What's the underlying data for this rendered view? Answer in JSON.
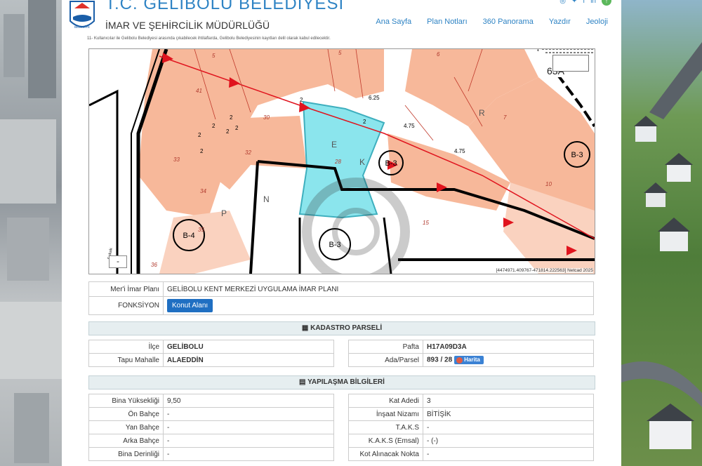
{
  "header": {
    "title": "T.C. GELİBOLU BELEDİYESİ",
    "subtitle": "İMAR VE ŞEHİRCİLİK MÜDÜRLÜĞÜ",
    "logo_text": "BELEDİYE",
    "nav": [
      "Ana Sayfa",
      "Plan Notları",
      "360 Panorama",
      "Yazdır",
      "Jeoloji"
    ],
    "social_icons": [
      "globe-icon",
      "twitter-icon",
      "facebook-icon",
      "linkedin-icon"
    ]
  },
  "notice": "11- Kullanıcılar ile Gelibolu Belediyesi arasında çıkabilecek ihtilaflarda, Gelibolu Belediyesinin kayıtları delil olarak kabul edilecektir.",
  "map": {
    "coordinates": "[4474971.409767-471814.222563] Netcad 2025",
    "zoom_out": "-",
    "labels": {
      "plots": [
        "41",
        "30",
        "32",
        "33",
        "34",
        "35",
        "36",
        "28",
        "15",
        "10",
        "7",
        "6",
        "5",
        "5"
      ],
      "widths": [
        "2",
        "2",
        "2",
        "2",
        "2",
        "2",
        "2",
        "2",
        "6.25",
        "4.75",
        "4.75"
      ],
      "zones": [
        "B-3",
        "B-3",
        "B-3",
        "B-4"
      ],
      "corner": "63A",
      "street": "Sokak",
      "letters": [
        "R",
        "N",
        "E",
        "K",
        "P"
      ]
    }
  },
  "plan_info": {
    "rows": [
      {
        "label": "Mer'i İmar Planı",
        "value": "GELİBOLU KENT MERKEZİ UYGULAMA İMAR PLANI"
      },
      {
        "label": "FONKSİYON",
        "value": "Konut Alanı"
      }
    ]
  },
  "kadastro": {
    "title": "KADASTRO PARSELİ",
    "left": [
      {
        "label": "İlçe",
        "value": "GELİBOLU"
      },
      {
        "label": "Tapu Mahalle",
        "value": "ALAEDDİN"
      }
    ],
    "right": [
      {
        "label": "Pafta",
        "value": "H17A09D3A"
      },
      {
        "label": "Ada/Parsel",
        "value": "893 / 28",
        "button": "Harita"
      }
    ]
  },
  "yapilasma": {
    "title": "YAPILAŞMA BİLGİLERİ",
    "left": [
      {
        "label": "Bina Yüksekliği",
        "value": "9,50"
      },
      {
        "label": "Ön Bahçe",
        "value": "-"
      },
      {
        "label": "Yan Bahçe",
        "value": "-"
      },
      {
        "label": "Arka Bahçe",
        "value": "-"
      },
      {
        "label": "Bina Derinliği",
        "value": "-"
      }
    ],
    "right": [
      {
        "label": "Kat Adedi",
        "value": "3"
      },
      {
        "label": "İnşaat Nizamı",
        "value": "BİTİŞİK"
      },
      {
        "label": "T.A.K.S",
        "value": "-"
      },
      {
        "label": "K.A.K.S (Emsal)",
        "value": "- (-)"
      },
      {
        "label": "Kot Alınacak Nokta",
        "value": "-"
      }
    ]
  },
  "colors": {
    "accent": "#2e83c4",
    "plot_fill": "#f7b89a",
    "selected_parcel": "#7fe3ec",
    "button": "#1f6fc2",
    "arrow": "#e0141e"
  }
}
